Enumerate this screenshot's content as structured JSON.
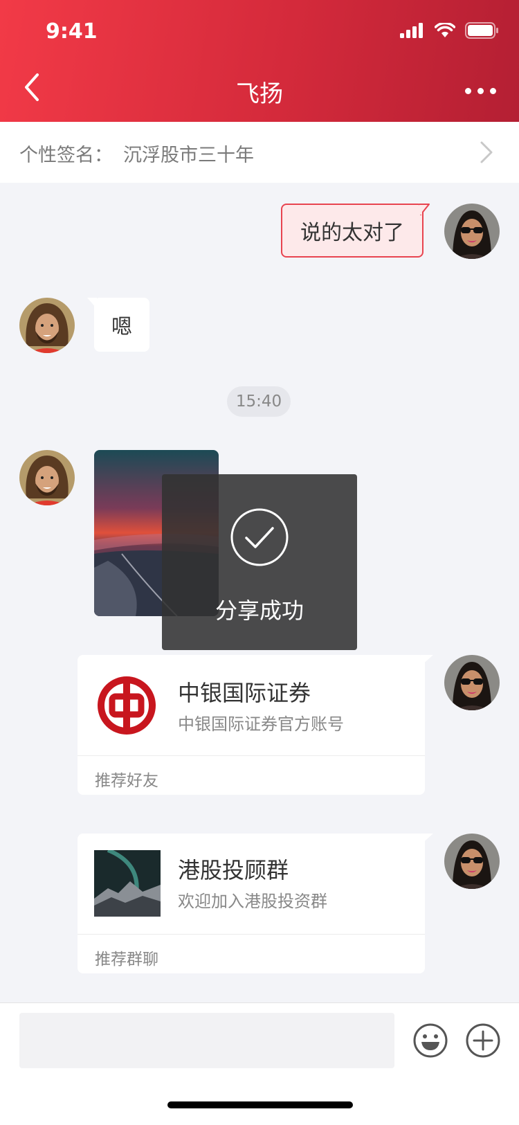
{
  "status": {
    "time": "9:41"
  },
  "header": {
    "title": "飞扬"
  },
  "signature": {
    "label": "个性签名：",
    "value": "沉浮股市三十年"
  },
  "messages": {
    "outgoing_text": "说的太对了",
    "incoming_text": "嗯",
    "timestamp": "15:40"
  },
  "toast": {
    "text": "分享成功"
  },
  "cards": [
    {
      "title": "中银国际证券",
      "subtitle": "中银国际证券官方账号",
      "footer": "推荐好友"
    },
    {
      "title": "港股投顾群",
      "subtitle": "欢迎加入港股投资群",
      "footer": "推荐群聊"
    }
  ],
  "input": {
    "placeholder": ""
  },
  "colors": {
    "brand": "#e8434f",
    "header_start": "#f23a47",
    "header_end": "#b41f33",
    "logo_red": "#c8161e"
  },
  "icons": [
    "signal-icon",
    "wifi-icon",
    "battery-icon",
    "back-chevron-icon",
    "more-icon",
    "chevron-right-icon",
    "checkmark-icon",
    "emoji-icon",
    "plus-icon"
  ]
}
